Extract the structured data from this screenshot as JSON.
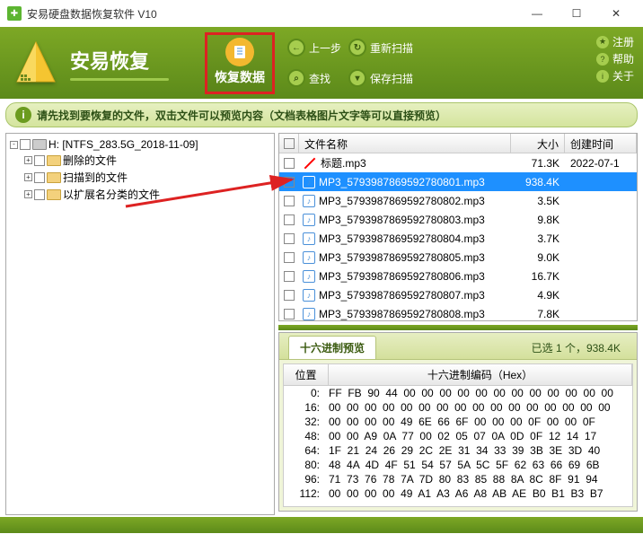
{
  "window": {
    "title": "安易硬盘数据恢复软件 V10"
  },
  "brand": {
    "name": "安易恢复"
  },
  "toolbar": {
    "recover": "恢复数据",
    "prev": "上一步",
    "rescan": "重新扫描",
    "find": "查找",
    "savescan": "保存扫描"
  },
  "rightbtns": {
    "register": "注册",
    "help": "帮助",
    "about": "关于"
  },
  "hint": {
    "text": "请先找到要恢复的文件，双击文件可以预览内容（文档表格图片文字等可以直接预览）"
  },
  "tree": {
    "root": "H: [NTFS_283.5G_2018-11-09]",
    "n1": "删除的文件",
    "n2": "扫描到的文件",
    "n3": "以扩展名分类的文件"
  },
  "cols": {
    "name": "文件名称",
    "size": "大小",
    "date": "创建时间"
  },
  "files": [
    {
      "name": "标题.mp3",
      "size": "71.3K",
      "date": "2022-07-1",
      "icon": "title"
    },
    {
      "name": "MP3_5793987869592780801.mp3",
      "size": "938.4K",
      "date": "",
      "sel": true
    },
    {
      "name": "MP3_5793987869592780802.mp3",
      "size": "3.5K",
      "date": ""
    },
    {
      "name": "MP3_5793987869592780803.mp3",
      "size": "9.8K",
      "date": ""
    },
    {
      "name": "MP3_5793987869592780804.mp3",
      "size": "3.7K",
      "date": ""
    },
    {
      "name": "MP3_5793987869592780805.mp3",
      "size": "9.0K",
      "date": ""
    },
    {
      "name": "MP3_5793987869592780806.mp3",
      "size": "16.7K",
      "date": ""
    },
    {
      "name": "MP3_5793987869592780807.mp3",
      "size": "4.9K",
      "date": ""
    },
    {
      "name": "MP3_5793987869592780808.mp3",
      "size": "7.8K",
      "date": ""
    }
  ],
  "preview": {
    "tab": "十六进制预览",
    "status": "已选 1 个，938.4K",
    "poscol": "位置",
    "hexcol": "十六进制编码（Hex）",
    "rows": [
      {
        "p": "0:",
        "d": "FF  FB  90  44  00  00  00  00  00  00  00  00  00  00  00  00"
      },
      {
        "p": "16:",
        "d": "00  00  00  00  00  00  00  00  00  00  00  00  00  00  00  00"
      },
      {
        "p": "32:",
        "d": "00  00  00  00  49  6E  66  6F  00  00  00  0F  00  00  0F"
      },
      {
        "p": "48:",
        "d": "00  00  A9  0A  77  00  02  05  07  0A  0D  0F  12  14  17"
      },
      {
        "p": "64:",
        "d": "1F  21  24  26  29  2C  2E  31  34  33  39  3B  3E  3D  40"
      },
      {
        "p": "80:",
        "d": "48  4A  4D  4F  51  54  57  5A  5C  5F  62  63  66  69  6B"
      },
      {
        "p": "96:",
        "d": "71  73  76  78  7A  7D  80  83  85  88  8A  8C  8F  91  94"
      },
      {
        "p": "112:",
        "d": "00  00  00  00  49  A1  A3  A6  A8  AB  AE  B0  B1  B3  B7"
      }
    ]
  }
}
